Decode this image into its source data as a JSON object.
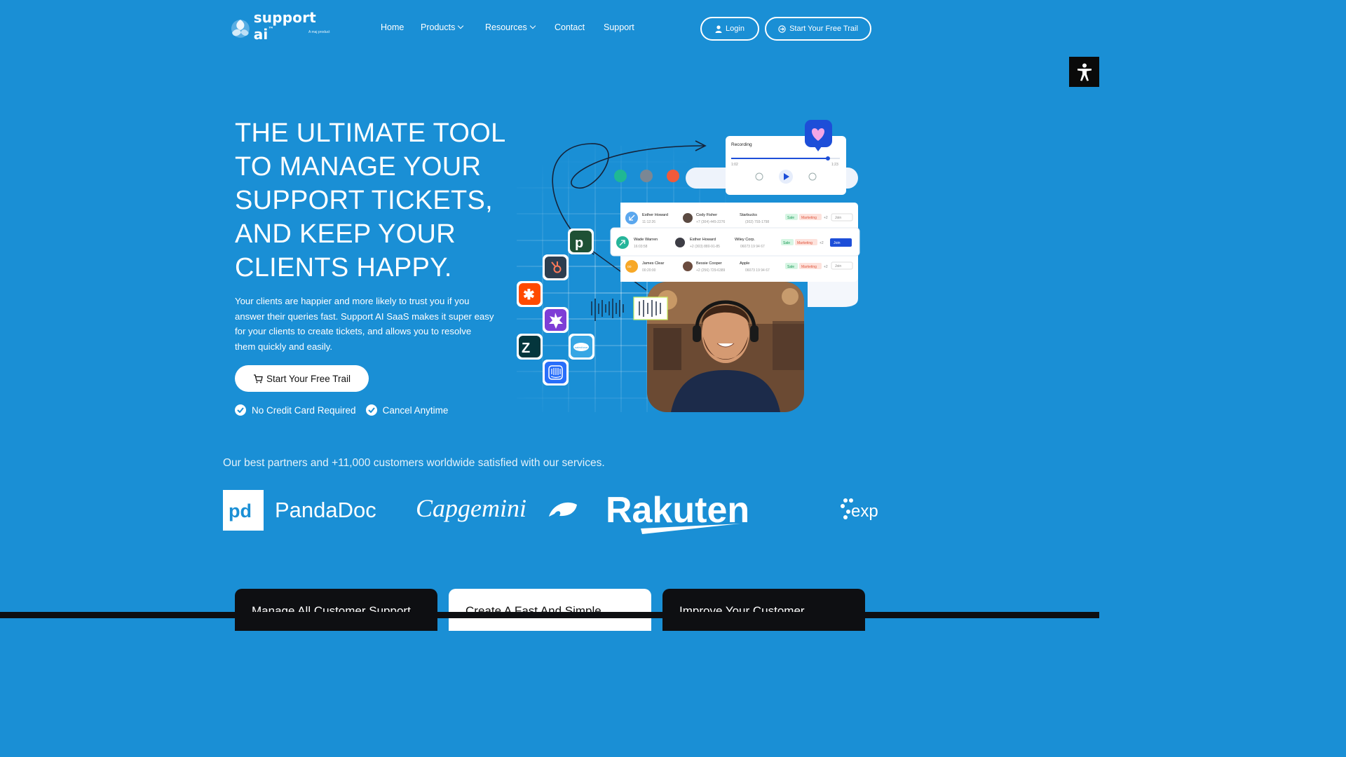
{
  "brand": {
    "name": "support ai",
    "tm": "™",
    "tagline": "A maj product"
  },
  "nav": {
    "items": [
      {
        "label": "Home",
        "dropdown": false
      },
      {
        "label": "Products",
        "dropdown": true
      },
      {
        "label": "Resources",
        "dropdown": true
      },
      {
        "label": "Contact",
        "dropdown": false
      },
      {
        "label": "Support",
        "dropdown": false
      }
    ],
    "login_label": "Login",
    "trial_label": "Start Your Free Trail"
  },
  "hero": {
    "title": "THE ULTIMATE TOOL TO MANAGE YOUR SUPPORT TICKETS, AND KEEP YOUR CLIENTS HAPPY.",
    "description": "Your clients are happier and more likely to trust you if you answer their queries fast. Support AI SaaS makes it super easy for your clients to create tickets, and allows you to resolve them quickly and easily.",
    "cta_label": "Start Your Free Trail",
    "checks": [
      "No Credit Card Required",
      "Cancel Anytime"
    ]
  },
  "visual": {
    "recording": {
      "title": "Recording",
      "elapsed": "1:02",
      "total": "1:23",
      "progress": 0.89
    },
    "contacts": [
      {
        "name": "Esther Howard",
        "time": "11:12:26",
        "agent": "Cody Fisher",
        "phone": "+7 (304) 445-2276",
        "company": "Starbucks",
        "company_phone": "(302) 793-1798",
        "tags": [
          "Sale",
          "Marketing",
          "+2"
        ],
        "action": "Join",
        "active": false
      },
      {
        "name": "Wade Warren",
        "time": "16:03:58",
        "agent": "Esther Howard",
        "phone": "+2 (303) 880-91-85",
        "company": "Wiley Corp.",
        "company_phone": "06073 19 94 67",
        "tags": [
          "Sale",
          "Marketing",
          "+2"
        ],
        "action": "Join",
        "active": true
      },
      {
        "name": "James Clear",
        "time": "00:20:00",
        "agent": "Bessie Cooper",
        "phone": "+2 (256) 729-6389",
        "company": "Apple",
        "company_phone": "06073 19 94 67",
        "tags": [
          "Sale",
          "Marketing",
          "+2"
        ],
        "action": "Join",
        "active": false
      }
    ],
    "integration_icons": [
      "pipedrive-icon",
      "hubspot-icon",
      "zapier-icon",
      "sparkle-icon",
      "zendesk-icon",
      "salesforce-icon",
      "intercom-icon"
    ]
  },
  "partners": {
    "text": "Our best partners and +11,000 customers worldwide satisfied with our services.",
    "logos": [
      "PandaDoc",
      "Capgemini",
      "Rakuten",
      "exp"
    ]
  },
  "cards": [
    {
      "title": "Manage All Customer Support",
      "theme": "dark"
    },
    {
      "title": "Create A Fast And Simple",
      "theme": "light"
    },
    {
      "title": "Improve Your Customer",
      "theme": "dark"
    }
  ],
  "colors": {
    "background": "#1a8fd5",
    "dark": "#0e0f12",
    "accent_blue": "#1d4ed8",
    "zapier": "#ff4a00",
    "pipedrive": "#1f5135"
  }
}
